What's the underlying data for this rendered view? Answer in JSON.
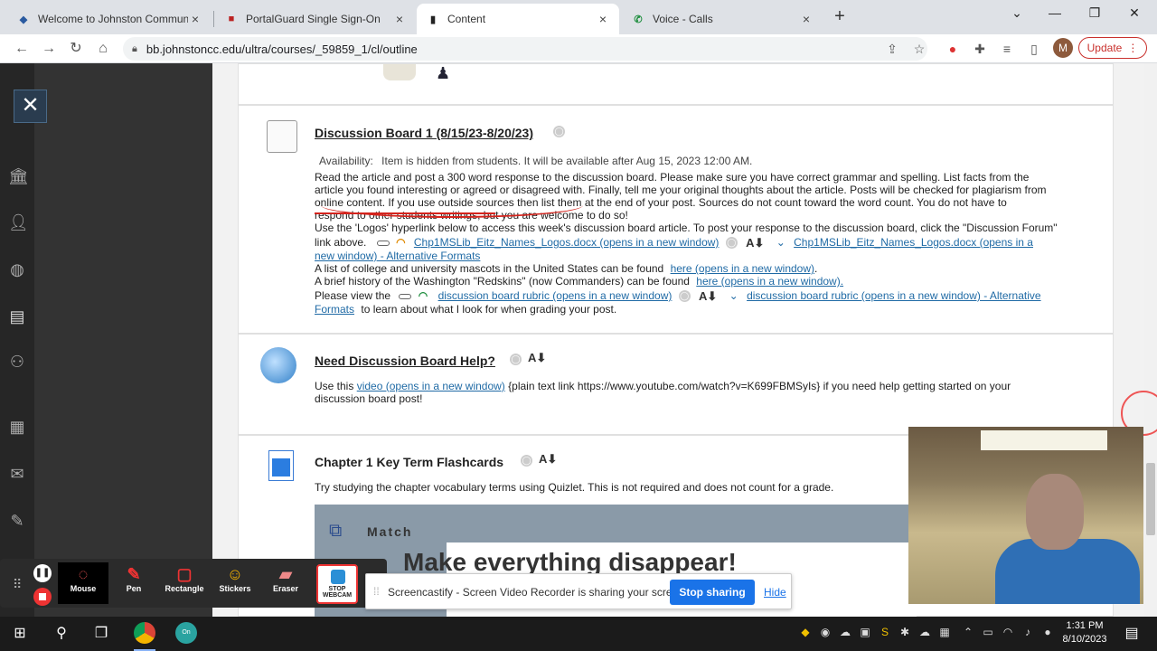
{
  "browser": {
    "tabs": [
      {
        "title": "Welcome to Johnston Communit",
        "icon": "shield-icon"
      },
      {
        "title": "PortalGuard Single Sign-On",
        "icon": "portalguard-icon"
      },
      {
        "title": "Content",
        "icon": "blackboard-icon"
      },
      {
        "title": "Voice - Calls",
        "icon": "phone-icon"
      }
    ],
    "url": "bb.johnstoncc.edu/ultra/courses/_59859_1/cl/outline",
    "profile_initial": "M",
    "update_label": "Update"
  },
  "items": {
    "discussion": {
      "title": "Discussion Board 1 (8/15/23-8/20/23)",
      "availability_label": "Availability:",
      "availability_text": "Item is hidden from students. It will be available after Aug 15, 2023 12:00 AM.",
      "para1_line1": "Read the article and post a 300 word response to the discussion board. Please make sure you have correct grammar and spelling.  List facts from the",
      "para1_line2": "article you found interesting or agreed or disagreed with.  Finally, tell me your original thoughts about the article.  Posts will be checked for plagiarism from",
      "para1_line3": "online content.  If you use outside sources then list them at the end of your post.  Sources do not count toward the word count.  You do not have to",
      "para1_line4": "respond to other students writings, but you are welcome to do so!",
      "para2_line1": "Use the 'Logos' hyperlink below to access this week's discussion board article. To post your response to the discussion board, click the \"Discussion Forum\"",
      "para2_line2_prefix": "link above.",
      "logos_link": "Chp1MSLib_Eitz_Names_Logos.docx  (opens in a new window)",
      "logos_alt_link_1": "Chp1MSLib_Eitz_Names_Logos.docx  (opens in a",
      "logos_alt_link_2": "new window) - Alternative Formats",
      "mascots_text": "A list of college and university mascots in the United States can be found",
      "mascots_link": "here (opens in a new window)",
      "redskins_text": "A brief history of the Washington \"Redskins\" (now Commanders) can be found",
      "redskins_link": "here (opens in a new window)",
      "rubric_prefix": "Please view the",
      "rubric_link": "discussion board rubric (opens in a new window)",
      "rubric_alt_link_1": "discussion board rubric (opens in a new window) - Alternative",
      "rubric_alt_link_2": "Formats",
      "rubric_suffix": "to learn about what I look for when grading your post."
    },
    "help": {
      "title": "Need Discussion Board Help?",
      "text_prefix": "Use this",
      "video_link": "video (opens in a new window)",
      "text_suffix": "{plain text link https://www.youtube.com/watch?v=K699FBMSyIs} if you need help getting started on your",
      "text_line2": "discussion board post!"
    },
    "flashcards": {
      "title": "Chapter 1 Key Term Flashcards",
      "description": "Try studying the chapter vocabulary terms using Quizlet. This is not required and does not count for a grade.",
      "embed_mode": "Match",
      "embed_headline": "Make everything disappear!"
    }
  },
  "screencastify": {
    "tools": [
      "Mouse",
      "Pen",
      "Rectangle",
      "Stickers",
      "Eraser"
    ],
    "stop_webcam": "STOP WEBCAM",
    "share_text": "Screencastify - Screen Video Recorder is sharing your screen.",
    "stop_sharing": "Stop sharing",
    "hide": "Hide"
  },
  "taskbar": {
    "time": "1:31 PM",
    "date": "8/10/2023"
  }
}
